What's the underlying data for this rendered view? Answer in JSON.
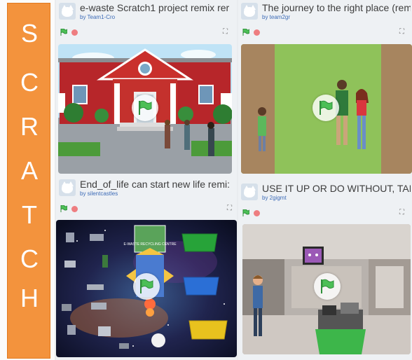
{
  "sidebar": {
    "letters": [
      "S",
      "C",
      "R",
      "A",
      "T",
      "C",
      "H"
    ],
    "color": "#f3933d"
  },
  "projects": [
    {
      "title": "e-waste Scratch1 project remix rer",
      "author": "by Team1-Cro"
    },
    {
      "title": "The journey to the right place (rem",
      "author": "by team2gr"
    },
    {
      "title": "End_of_life can start new life remi:",
      "author": "by silentcastles"
    },
    {
      "title": "USE IT UP OR DO WITHOUT, TAE",
      "author": "by 2gigmt"
    }
  ],
  "scene3": {
    "sign_text": "E-WASTE RECYCLING CENTRE"
  },
  "icons": {
    "green_flag": "green-flag-icon",
    "stop": "stop-icon",
    "fullscreen": "fullscreen-icon",
    "play": "play-flag-icon"
  },
  "colors": {
    "flag_green": "#4cbf56",
    "stop_red": "#ee7d80",
    "author_blue": "#3c6bb7"
  }
}
